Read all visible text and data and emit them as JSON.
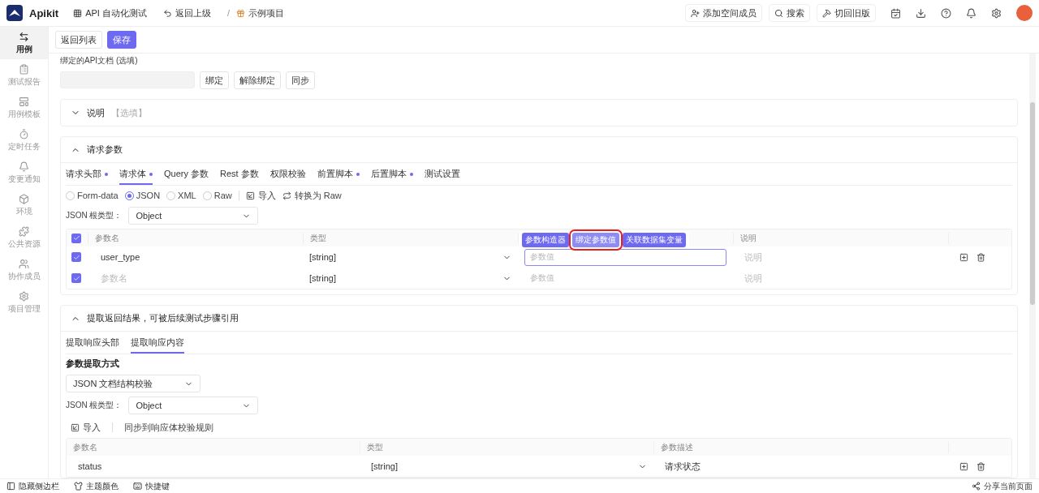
{
  "header": {
    "brand": "Apikit",
    "module": "API 自动化测试",
    "back": "返回上级",
    "separator": "/",
    "project": "示例项目",
    "actions": [
      "添加空间成员",
      "搜索",
      "切回旧版"
    ]
  },
  "sidebar": {
    "items": [
      {
        "label": "用例",
        "selected": true
      },
      {
        "label": "测试报告",
        "selected": false
      },
      {
        "label": "用例模板",
        "selected": false
      },
      {
        "label": "定时任务",
        "selected": false
      },
      {
        "label": "变更通知",
        "selected": false
      },
      {
        "label": "环境",
        "selected": false
      },
      {
        "label": "公共资源",
        "selected": false
      },
      {
        "label": "协作成员",
        "selected": false
      },
      {
        "label": "项目管理",
        "selected": false
      }
    ]
  },
  "toolbar": {
    "buttons": [
      {
        "label": "返回列表",
        "primary": false
      },
      {
        "label": "保存",
        "primary": true
      }
    ]
  },
  "api_binding": {
    "label": "绑定的API文档 (选填)",
    "buttons": [
      "绑定",
      "解除绑定",
      "同步"
    ]
  },
  "description_card": {
    "title": "说明",
    "hint": "【选填】",
    "expanded": false
  },
  "request_card": {
    "title": "请求参数",
    "expanded": true,
    "tabs": [
      {
        "label": "请求头部",
        "dot": true,
        "selected": false
      },
      {
        "label": "请求体",
        "dot": true,
        "selected": true
      },
      {
        "label": "Query 参数",
        "dot": false,
        "selected": false
      },
      {
        "label": "Rest 参数",
        "dot": false,
        "selected": false
      },
      {
        "label": "权限校验",
        "dot": false,
        "selected": false
      },
      {
        "label": "前置脚本",
        "dot": true,
        "selected": false
      },
      {
        "label": "后置脚本",
        "dot": true,
        "selected": false
      },
      {
        "label": "测试设置",
        "dot": false,
        "selected": false
      }
    ],
    "body_types": [
      {
        "label": "Form-data",
        "selected": false
      },
      {
        "label": "JSON",
        "selected": true
      },
      {
        "label": "XML",
        "selected": false
      },
      {
        "label": "Raw",
        "selected": false
      }
    ],
    "import": "导入",
    "convert": "转换为 Raw",
    "root_type": {
      "label": "JSON 根类型：",
      "value": "Object"
    },
    "select_all": {
      "checked": true
    },
    "columns": [
      "参数名",
      "类型",
      "说明"
    ],
    "value_tools": [
      {
        "label": "参数构造器",
        "highlighted": false
      },
      {
        "label": "绑定参数值",
        "highlighted": true
      },
      {
        "label": "关联数据集变量",
        "highlighted": false
      }
    ],
    "rows": [
      {
        "checked": true,
        "name": "user_type",
        "name_placeholder": false,
        "type": "[string]",
        "value_placeholder": "参数值",
        "focused": true,
        "note_placeholder": "说明",
        "actions": true
      },
      {
        "checked": true,
        "name": "参数名",
        "name_placeholder": true,
        "type": "[string]",
        "value_placeholder": "参数值",
        "focused": false,
        "note_placeholder": "说明",
        "actions": false
      }
    ]
  },
  "extract_card": {
    "title": "提取返回结果，可被后续测试步骤引用",
    "expanded": true,
    "tabs": [
      {
        "label": "提取响应头部",
        "selected": false
      },
      {
        "label": "提取响应内容",
        "selected": true
      }
    ],
    "method_label": "参数提取方式",
    "method": "JSON 文档结构校验",
    "root_type": {
      "label": "JSON 根类型：",
      "value": "Object"
    },
    "import": "导入",
    "sync": "同步到响应体校验规则",
    "columns": [
      "参数名",
      "类型",
      "参数描述"
    ],
    "rows": [
      {
        "name": "status",
        "type": "[string]",
        "description": "请求状态"
      }
    ]
  },
  "footer": {
    "items": [
      "隐藏侧边栏",
      "主题颜色",
      "快捷键"
    ],
    "share": "分享当前页面"
  }
}
